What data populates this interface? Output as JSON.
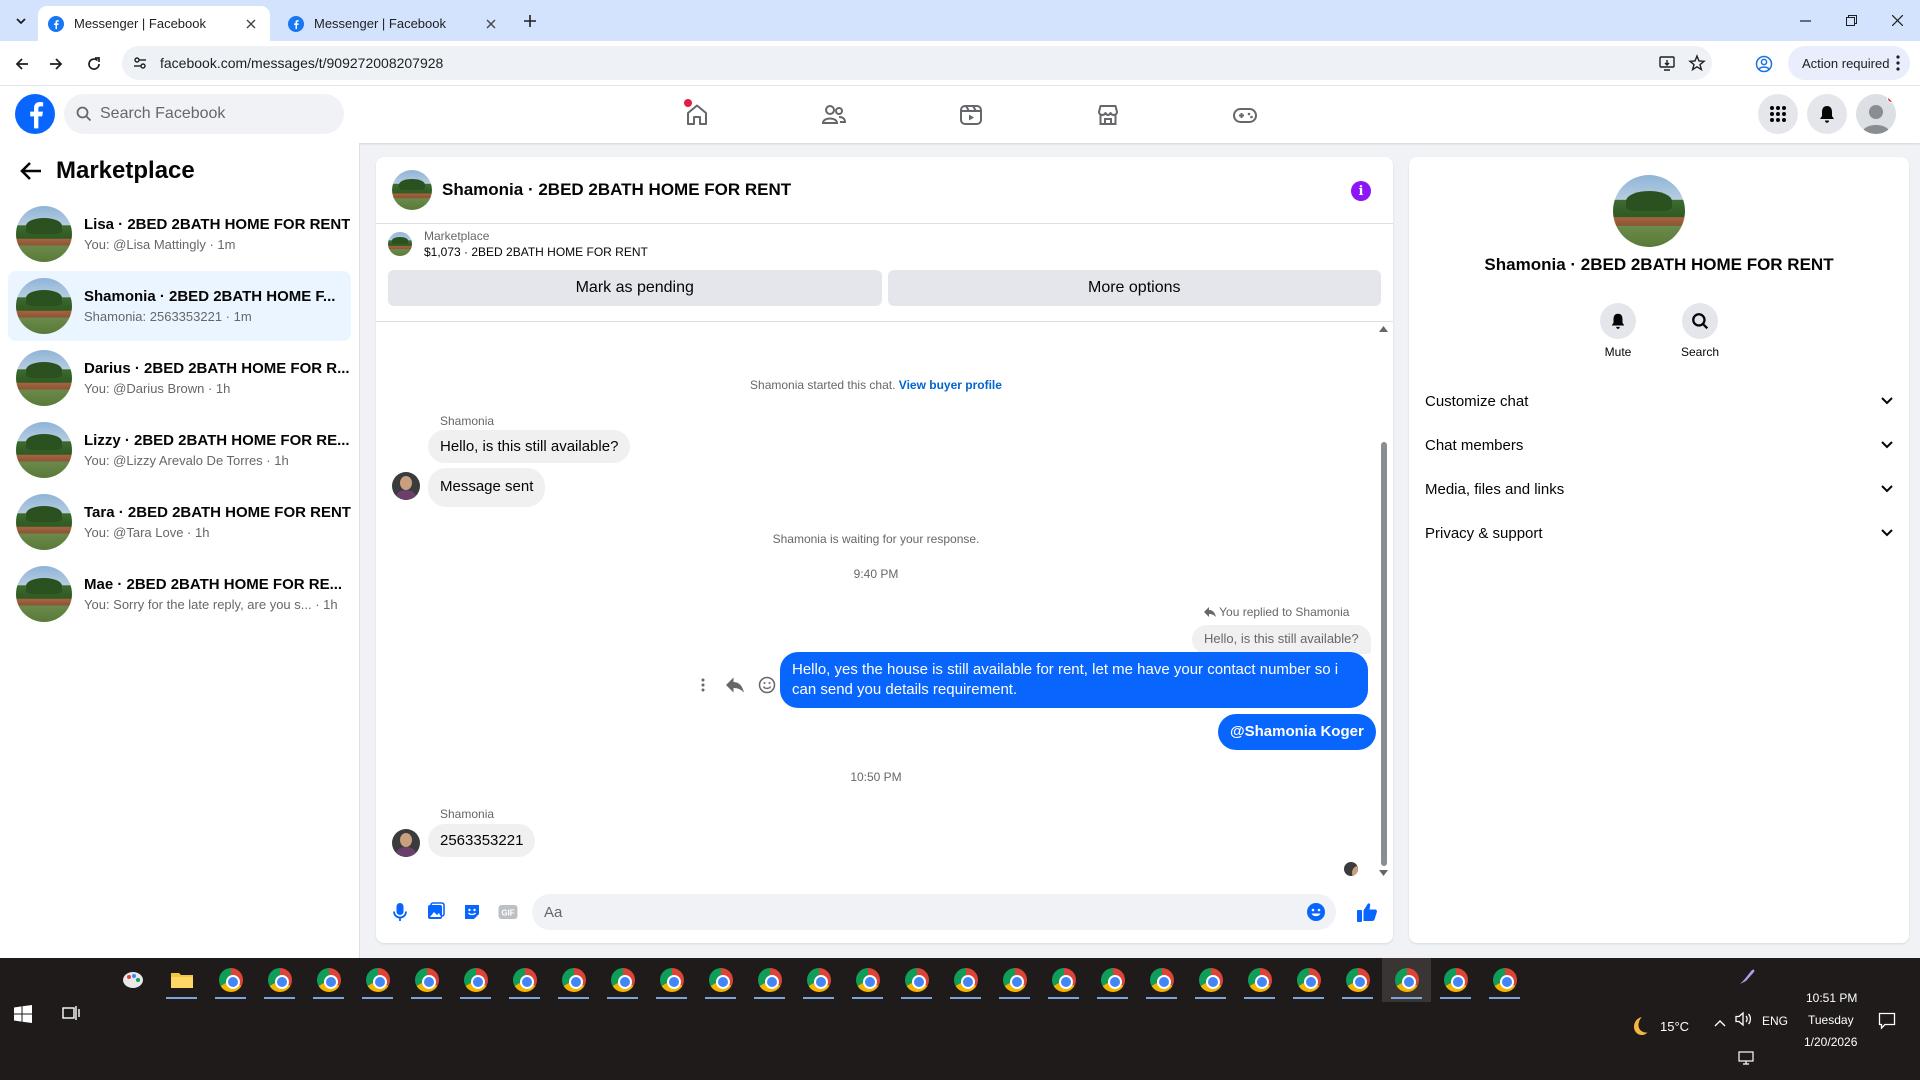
{
  "browser": {
    "tabs": [
      {
        "title": "Messenger | Facebook",
        "active": true
      },
      {
        "title": "Messenger | Facebook",
        "active": false
      }
    ],
    "url": "facebook.com/messages/t/909272008207928",
    "action_required": "Action required"
  },
  "fb": {
    "search_placeholder": "Search Facebook",
    "brand_color": "#0866ff"
  },
  "left": {
    "title": "Marketplace",
    "conversations": [
      {
        "name": "Lisa · 2BED 2BATH HOME FOR RENT",
        "preview": "You: @Lisa Mattingly · 1m",
        "active": false
      },
      {
        "name": "Shamonia · 2BED 2BATH HOME F...",
        "preview": "Shamonia: 2563353221 · 1m",
        "active": true
      },
      {
        "name": "Darius · 2BED 2BATH HOME FOR R...",
        "preview": "You: @Darius Brown · 1h",
        "active": false
      },
      {
        "name": "Lizzy · 2BED 2BATH HOME FOR RE...",
        "preview": "You: @Lizzy Arevalo De Torres · 1h",
        "active": false
      },
      {
        "name": "Tara · 2BED 2BATH HOME FOR RENT",
        "preview": "You: @Tara Love · 1h",
        "active": false
      },
      {
        "name": "Mae · 2BED 2BATH HOME FOR RE...",
        "preview": "You: Sorry for the late reply, are you s... · 1h",
        "active": false
      }
    ]
  },
  "chat": {
    "title": "Shamonia · 2BED 2BATH HOME FOR RENT",
    "listing_label": "Marketplace",
    "listing_detail": "$1,073 · 2BED 2BATH HOME FOR RENT",
    "mark_pending": "Mark as pending",
    "more_options": "More options",
    "started_note": "Shamonia started this chat.",
    "view_profile": "View buyer profile",
    "sender1": "Shamonia",
    "msg1": "Hello, is this still available?",
    "msg2": "Message sent",
    "waiting_note": "Shamonia is waiting for your response.",
    "time1": "9:40 PM",
    "replied_to": "You replied to Shamonia",
    "quote": "Hello, is this still available?",
    "reply_text": "Hello, yes the house is still available for rent, let me have your contact number so i can send you details requirement.",
    "mention": "@Shamonia Koger",
    "time2": "10:50 PM",
    "sender2": "Shamonia",
    "msg3": "2563353221",
    "composer_placeholder": "Aa"
  },
  "details": {
    "title": "Shamonia · 2BED 2BATH HOME FOR RENT",
    "mute": "Mute",
    "search": "Search",
    "sections": [
      "Customize chat",
      "Chat members",
      "Media, files and links",
      "Privacy & support"
    ]
  },
  "taskbar": {
    "weather": "15°C",
    "lang": "ENG",
    "time": "10:51 PM",
    "day": "Tuesday",
    "date": "1/20/2026"
  }
}
